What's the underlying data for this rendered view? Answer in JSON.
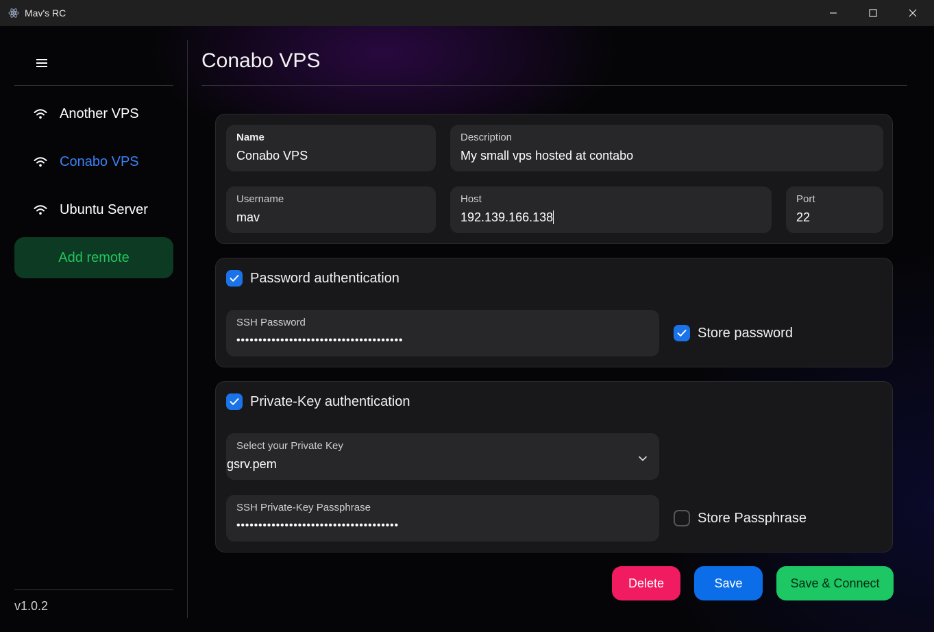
{
  "window": {
    "title": "Mav's RC",
    "icon": "electron-icon",
    "controls": [
      "minimize-icon",
      "maximize-icon",
      "close-icon"
    ]
  },
  "sidebar": {
    "menu_icon": "hamburger-icon",
    "items": [
      {
        "label": "Another VPS",
        "icon": "wifi-icon",
        "active": false
      },
      {
        "label": "Conabo VPS",
        "icon": "wifi-icon",
        "active": true
      },
      {
        "label": "Ubuntu Server",
        "icon": "wifi-icon",
        "active": false
      }
    ],
    "add_label": "Add remote",
    "version": "v1.0.2"
  },
  "main": {
    "title": "Conabo VPS",
    "connection": {
      "name_label": "Name",
      "name_value": "Conabo VPS",
      "description_label": "Description",
      "description_value": "My small vps hosted at contabo",
      "username_label": "Username",
      "username_value": "mav",
      "host_label": "Host",
      "host_value": "192.139.166.138",
      "port_label": "Port",
      "port_value": "22"
    },
    "password_auth": {
      "label": "Password authentication",
      "checked": true,
      "password_label": "SSH Password",
      "password_mask": "••••••••••••••••••••••••••••••••••••••",
      "store_label": "Store password",
      "store_checked": true
    },
    "key_auth": {
      "label": "Private-Key authentication",
      "checked": true,
      "select_label": "Select your Private Key",
      "select_value": "gsrv.pem",
      "passphrase_label": "SSH Private-Key Passphrase",
      "passphrase_mask": "•••••••••••••••••••••••••••••••••••••",
      "store_label": "Store Passphrase",
      "store_checked": false
    },
    "buttons": {
      "delete": "Delete",
      "save": "Save",
      "save_connect": "Save & Connect"
    }
  },
  "colors": {
    "accent_blue": "#1a73e8",
    "active_text": "#3b82f6",
    "delete": "#f01b61",
    "save": "#0b6ee8",
    "save_connect": "#1dc763",
    "add_remote_bg": "#0d3a22",
    "add_remote_text": "#22c55e"
  }
}
